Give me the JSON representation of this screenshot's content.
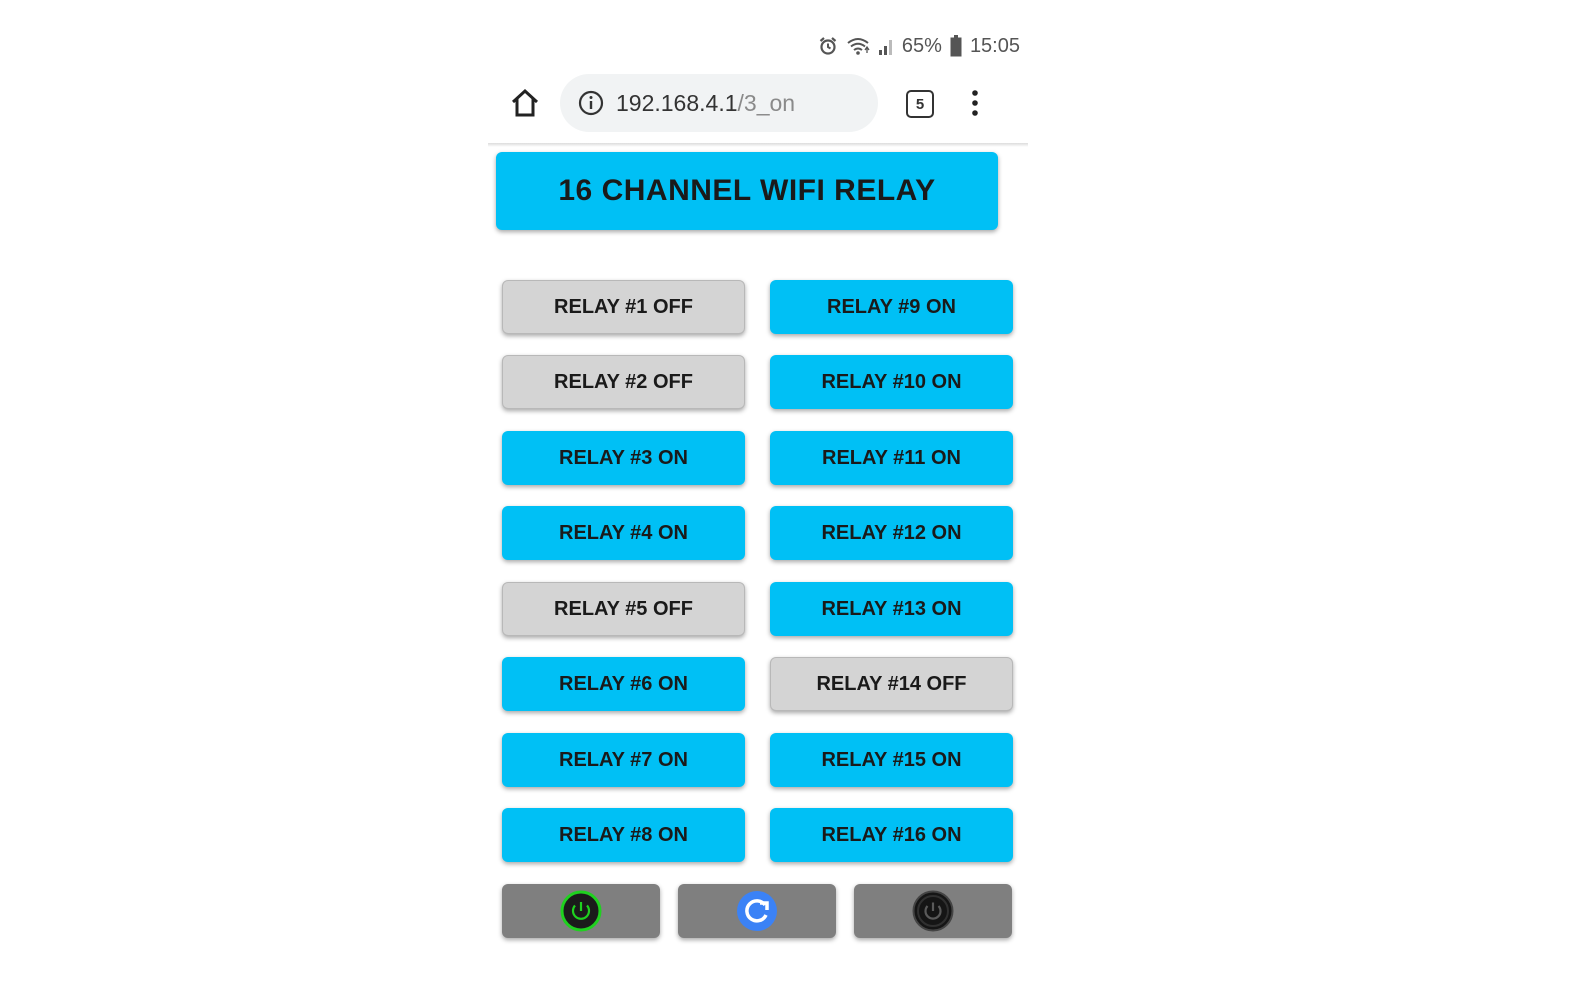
{
  "status_bar": {
    "battery_percent": "65%",
    "time": "15:05"
  },
  "browser": {
    "url_host": "192.168.4.1",
    "url_path": "/3_on",
    "tab_count": "5"
  },
  "page": {
    "title": "16 CHANNEL WIFI RELAY",
    "relays": [
      {
        "label": "RELAY #1 OFF",
        "state": "off"
      },
      {
        "label": "RELAY #2 OFF",
        "state": "off"
      },
      {
        "label": "RELAY #3 ON",
        "state": "on"
      },
      {
        "label": "RELAY #4 ON",
        "state": "on"
      },
      {
        "label": "RELAY #5 OFF",
        "state": "off"
      },
      {
        "label": "RELAY #6 ON",
        "state": "on"
      },
      {
        "label": "RELAY #7 ON",
        "state": "on"
      },
      {
        "label": "RELAY #8 ON",
        "state": "on"
      },
      {
        "label": "RELAY #9 ON",
        "state": "on"
      },
      {
        "label": "RELAY #10 ON",
        "state": "on"
      },
      {
        "label": "RELAY #11 ON",
        "state": "on"
      },
      {
        "label": "RELAY #12 ON",
        "state": "on"
      },
      {
        "label": "RELAY #13 ON",
        "state": "on"
      },
      {
        "label": "RELAY #14 OFF",
        "state": "off"
      },
      {
        "label": "RELAY #15 ON",
        "state": "on"
      },
      {
        "label": "RELAY #16 ON",
        "state": "on"
      }
    ],
    "controls": [
      {
        "icon": "power-on-icon"
      },
      {
        "icon": "refresh-icon"
      },
      {
        "icon": "power-off-icon"
      }
    ]
  },
  "colors": {
    "relay_on": "#00c0f5",
    "relay_off": "#d4d4d4",
    "control_button": "#7f7f7f",
    "power_on_green": "#1fd11f",
    "refresh_blue": "#3b82f6"
  }
}
